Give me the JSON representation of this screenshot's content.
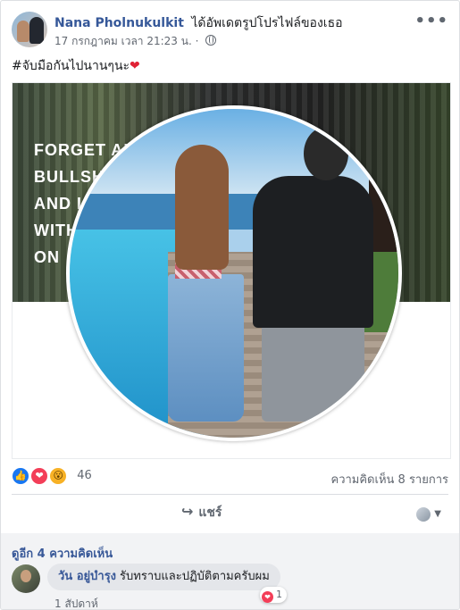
{
  "post": {
    "author": "Nana Pholnukulkit",
    "action": "ได้อัพเดตรูปโปรไฟล์ของเธอ",
    "timestamp": "17 กรกฎาคม เวลา 21:23 น.",
    "separator": "·",
    "more_icon": "•••",
    "caption": "#จับมือกันไปนานๆนะ",
    "caption_emoji": "❤"
  },
  "cover": {
    "text_lines": [
      "FORGET AL",
      "BULLSHI",
      "AND L",
      "WITH",
      "ON"
    ]
  },
  "reactions": {
    "count": "46",
    "types": [
      "like",
      "love",
      "wow"
    ],
    "like_glyph": "👍",
    "love_glyph": "❤",
    "wow_glyph": "😮",
    "comments_label": "ความคิดเห็น 8 รายการ"
  },
  "actions": {
    "share_icon": "↪",
    "share_label": "แชร์",
    "caret": "▼"
  },
  "comments": {
    "more_label": "ดูอีก 4 ความคิดเห็น",
    "items": [
      {
        "author": "วัน อยู่บำรุง",
        "text": "รับทราบและปฏิบัติตามครับผม",
        "reaction_count": "1",
        "reaction_glyph": "❤",
        "time": "1 สัปดาห์"
      }
    ]
  },
  "colors": {
    "link": "#365899",
    "heart": "#e02235",
    "like": "#1877f2",
    "love": "#f33e58",
    "wow": "#f7b125"
  }
}
